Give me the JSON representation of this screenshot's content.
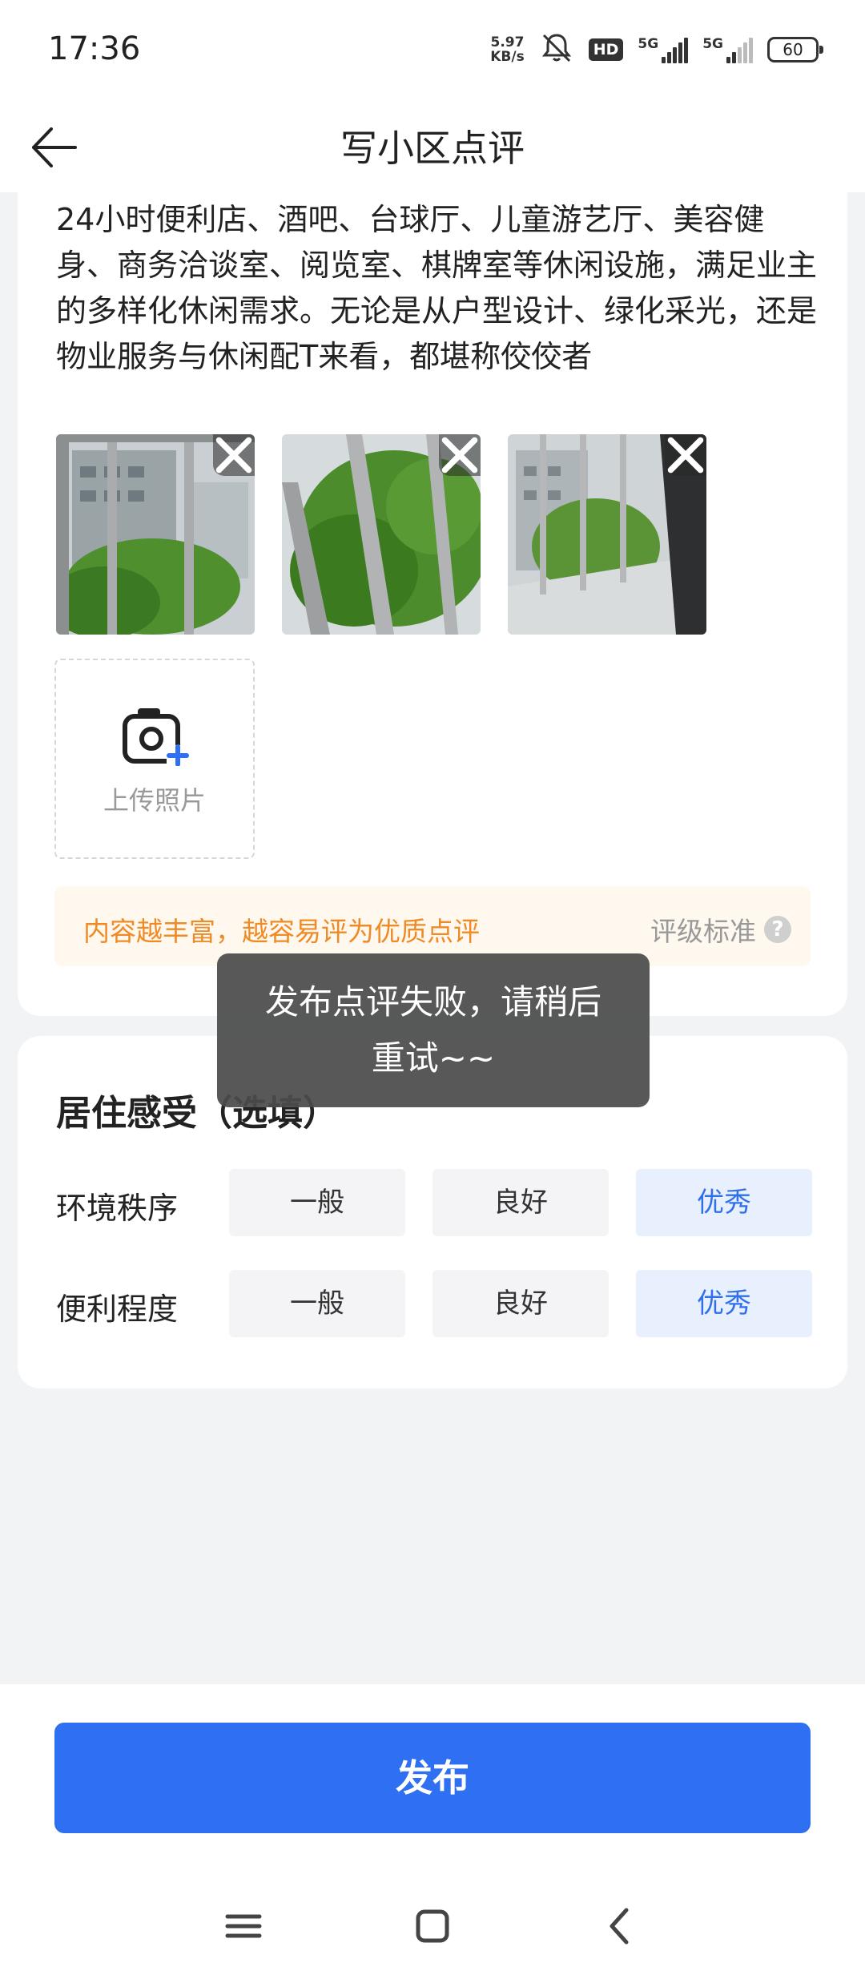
{
  "status_bar": {
    "time": "17:36",
    "speed_value": "5.97",
    "speed_unit": "KB/s",
    "hd_label": "HD",
    "signal1_label": "5G",
    "signal2_label": "5G",
    "battery": "60"
  },
  "header": {
    "title": "写小区点评",
    "back_icon": "arrow-left-icon"
  },
  "review": {
    "text": "设计中，规划了四季变换的景观，打造出独特的园林景观，有凉亭、假山、小桥流水，还配备了高级西餐厅、24小时便利店、酒吧、台球厅、儿童游艺厅、美容健身、商务洽谈室、阅览室、棋牌室等休闲设施，满足业主的多样化休闲需求。无论是从户型设计、绿化采光，还是物业服务与休闲配T来看，都堪称佼佼者",
    "photos": [
      {
        "remove_icon": "close-icon"
      },
      {
        "remove_icon": "close-icon"
      },
      {
        "remove_icon": "close-icon"
      }
    ],
    "upload_label": "上传照片",
    "upload_icon": "camera-plus-icon",
    "tip_text": "内容越丰富，越容易评为优质点评",
    "tip_link": "评级标准",
    "help_icon": "question-icon",
    "help_glyph": "?"
  },
  "living": {
    "title": "居住感受（选填）",
    "rows": [
      {
        "label": "环境秩序",
        "options": [
          "一般",
          "良好",
          "优秀"
        ],
        "selected": "优秀"
      },
      {
        "label": "便利程度",
        "options": [
          "一般",
          "良好",
          "优秀"
        ],
        "selected": "优秀"
      }
    ]
  },
  "toast": {
    "message": "发布点评失败，请稍后重试~~"
  },
  "footer": {
    "publish_label": "发布"
  },
  "colors": {
    "accent": "#2f6ff1",
    "selected_bg": "#e8f0fd",
    "tip_text": "#f08a24",
    "tip_bg": "#fff8ef"
  }
}
